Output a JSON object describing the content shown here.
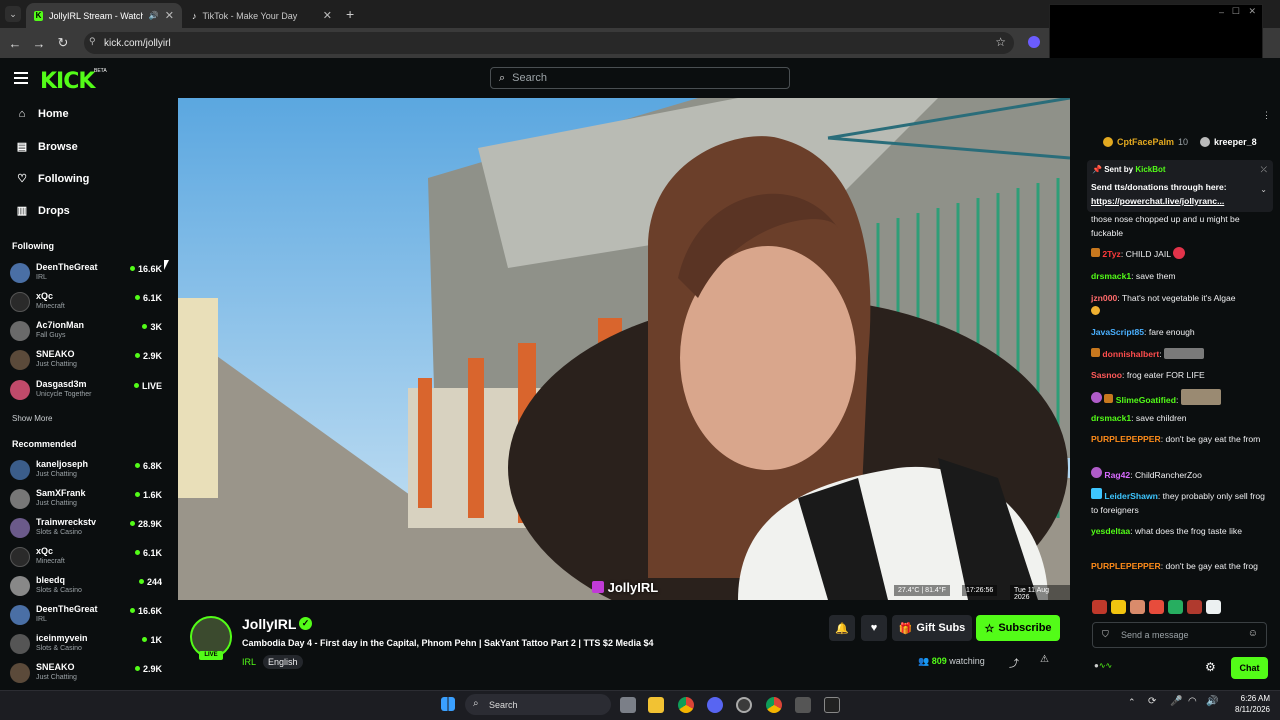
{
  "browser": {
    "tabs": [
      {
        "label": "JollyIRL Stream - Watch Live",
        "active": true
      },
      {
        "label": "TikTok - Make Your Day",
        "active": false
      }
    ],
    "url": "kick.com/jollyirl"
  },
  "header": {
    "logo": "KICK",
    "beta": "BETA",
    "search_placeholder": "Search"
  },
  "sidebar": {
    "nav": [
      {
        "label": "Home",
        "icon": "home-icon"
      },
      {
        "label": "Browse",
        "icon": "browse-icon"
      },
      {
        "label": "Following",
        "icon": "heart-icon"
      },
      {
        "label": "Drops",
        "icon": "drops-icon"
      }
    ],
    "following_title": "Following",
    "following": [
      {
        "name": "DeenTheGreat",
        "category": "IRL",
        "viewers": "16.6K"
      },
      {
        "name": "xQc",
        "category": "Minecraft",
        "viewers": "6.1K"
      },
      {
        "name": "Ac7ionMan",
        "category": "Fall Guys",
        "viewers": "3K"
      },
      {
        "name": "SNEAKO",
        "category": "Just Chatting",
        "viewers": "2.9K"
      },
      {
        "name": "Dasgasd3m",
        "category": "Unicycle Together",
        "viewers": "LIVE"
      }
    ],
    "show_more": "Show More",
    "recommended_title": "Recommended",
    "recommended": [
      {
        "name": "kaneljoseph",
        "category": "Just Chatting",
        "viewers": "6.8K"
      },
      {
        "name": "SamXFrank",
        "category": "Just Chatting",
        "viewers": "1.6K"
      },
      {
        "name": "Trainwreckstv",
        "category": "Slots & Casino",
        "viewers": "28.9K"
      },
      {
        "name": "xQc",
        "category": "Minecraft",
        "viewers": "6.1K"
      },
      {
        "name": "bleedq",
        "category": "Slots & Casino",
        "viewers": "244"
      },
      {
        "name": "DeenTheGreat",
        "category": "IRL",
        "viewers": "16.6K"
      },
      {
        "name": "iceinmyvein",
        "category": "Slots & Casino",
        "viewers": "1K"
      },
      {
        "name": "SNEAKO",
        "category": "Just Chatting",
        "viewers": "2.9K"
      }
    ]
  },
  "video": {
    "watermark": "JollyIRL",
    "overlay_weather": "27.4°C | 81.4°F",
    "overlay_time": "17:26:56",
    "overlay_date": "Tue 11 Aug 2026"
  },
  "stream": {
    "channel": "JollyIRL",
    "live_badge": "LIVE",
    "title": "Cambodia Day 4 - First day in the Capital, Phnom Pehn | SakYant Tattoo Part 2 | TTS $2 Media $4",
    "category": "IRL",
    "language": "English",
    "gift_subs": "Gift Subs",
    "subscribe": "Subscribe",
    "viewers": "809",
    "watching_label": "watching"
  },
  "chat": {
    "gifters": [
      {
        "name": "CptFacePalm",
        "count": "10"
      },
      {
        "name": "kreeper_8",
        "count": ""
      }
    ],
    "pinned": {
      "sent_by_label": "Sent by",
      "sender": "KickBot",
      "text": "Send tts/donations through here:",
      "link": "https://powerchat.live/jollyranc..."
    },
    "messages": [
      {
        "user": "",
        "color": "#efeff1",
        "text": "those nose chopped up and u might be fuckable"
      },
      {
        "user": "2Tyz",
        "color": "#ff3b3b",
        "text": "CHILD JAIL"
      },
      {
        "user": "drsmack1",
        "color": "#53fc18",
        "text": "save them"
      },
      {
        "user": "jzn000",
        "color": "#ff6b6b",
        "text": "That's not vegetable it's Algae"
      },
      {
        "user": "JavaScript85",
        "color": "#4ab0ff",
        "text": "fare enough"
      },
      {
        "user": "donnishalbert",
        "color": "#ff4d4d",
        "text": ""
      },
      {
        "user": "Sasnoo",
        "color": "#ff5a5a",
        "text": "frog eater FOR LIFE"
      },
      {
        "user": "SlimeGoatified",
        "color": "#53fc18",
        "text": ""
      },
      {
        "user": "drsmack1",
        "color": "#53fc18",
        "text": "save children"
      },
      {
        "user": "PURPLEPEPPER",
        "color": "#ff8c1a",
        "text": "don't be gay eat the from"
      },
      {
        "user": "Rag42",
        "color": "#d96bff",
        "text": "ChildRancherZoo"
      },
      {
        "user": "LeiderShawn",
        "color": "#3ec6ff",
        "text": "they probably only sell frog to foreigners"
      },
      {
        "user": "yesdeltaa",
        "color": "#53fc18",
        "text": "what does the frog taste like"
      },
      {
        "user": "PURPLEPEPPER",
        "color": "#ff8c1a",
        "text": "don't be gay eat the frog"
      }
    ],
    "input_placeholder": "Send a message",
    "chat_button": "Chat"
  },
  "taskbar": {
    "search": "Search",
    "time": "6:26 AM",
    "date": "8/11/2026"
  }
}
